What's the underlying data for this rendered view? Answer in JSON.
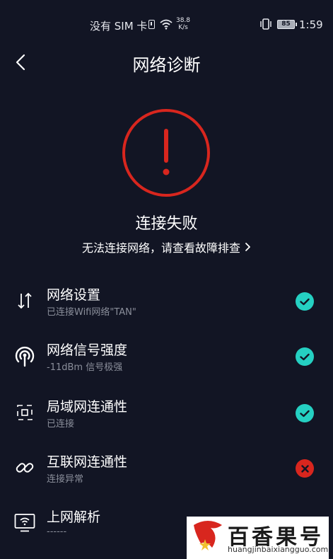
{
  "status_bar": {
    "carrier": "没有 SIM 卡",
    "speed_value": "38.8",
    "speed_unit": "K/s",
    "battery": "85",
    "time": "1:59"
  },
  "header": {
    "title": "网络诊断"
  },
  "hero": {
    "status_title": "连接失败",
    "help_link": "无法连接网络，请查看故障排查",
    "accent": "#d8261e"
  },
  "items": [
    {
      "title": "网络设置",
      "subtitle": "已连接Wifi网络\"TAN\"",
      "icon": "transfer-arrows-icon",
      "status": "ok"
    },
    {
      "title": "网络信号强度",
      "subtitle": "-11dBm 信号极强",
      "icon": "signal-icon",
      "status": "ok"
    },
    {
      "title": "局域网连通性",
      "subtitle": "已连接",
      "icon": "lan-icon",
      "status": "ok"
    },
    {
      "title": "互联网连通性",
      "subtitle": "连接异常",
      "icon": "link-icon",
      "status": "error"
    },
    {
      "title": "上网解析",
      "subtitle": "------",
      "icon": "monitor-wifi-icon",
      "status": "none"
    }
  ],
  "colors": {
    "ok": "#25d0c2",
    "error": "#d8261e",
    "background": "#121524"
  },
  "watermark": {
    "brand": "百香果号",
    "url": "huangjinbaixiangguo.com"
  }
}
